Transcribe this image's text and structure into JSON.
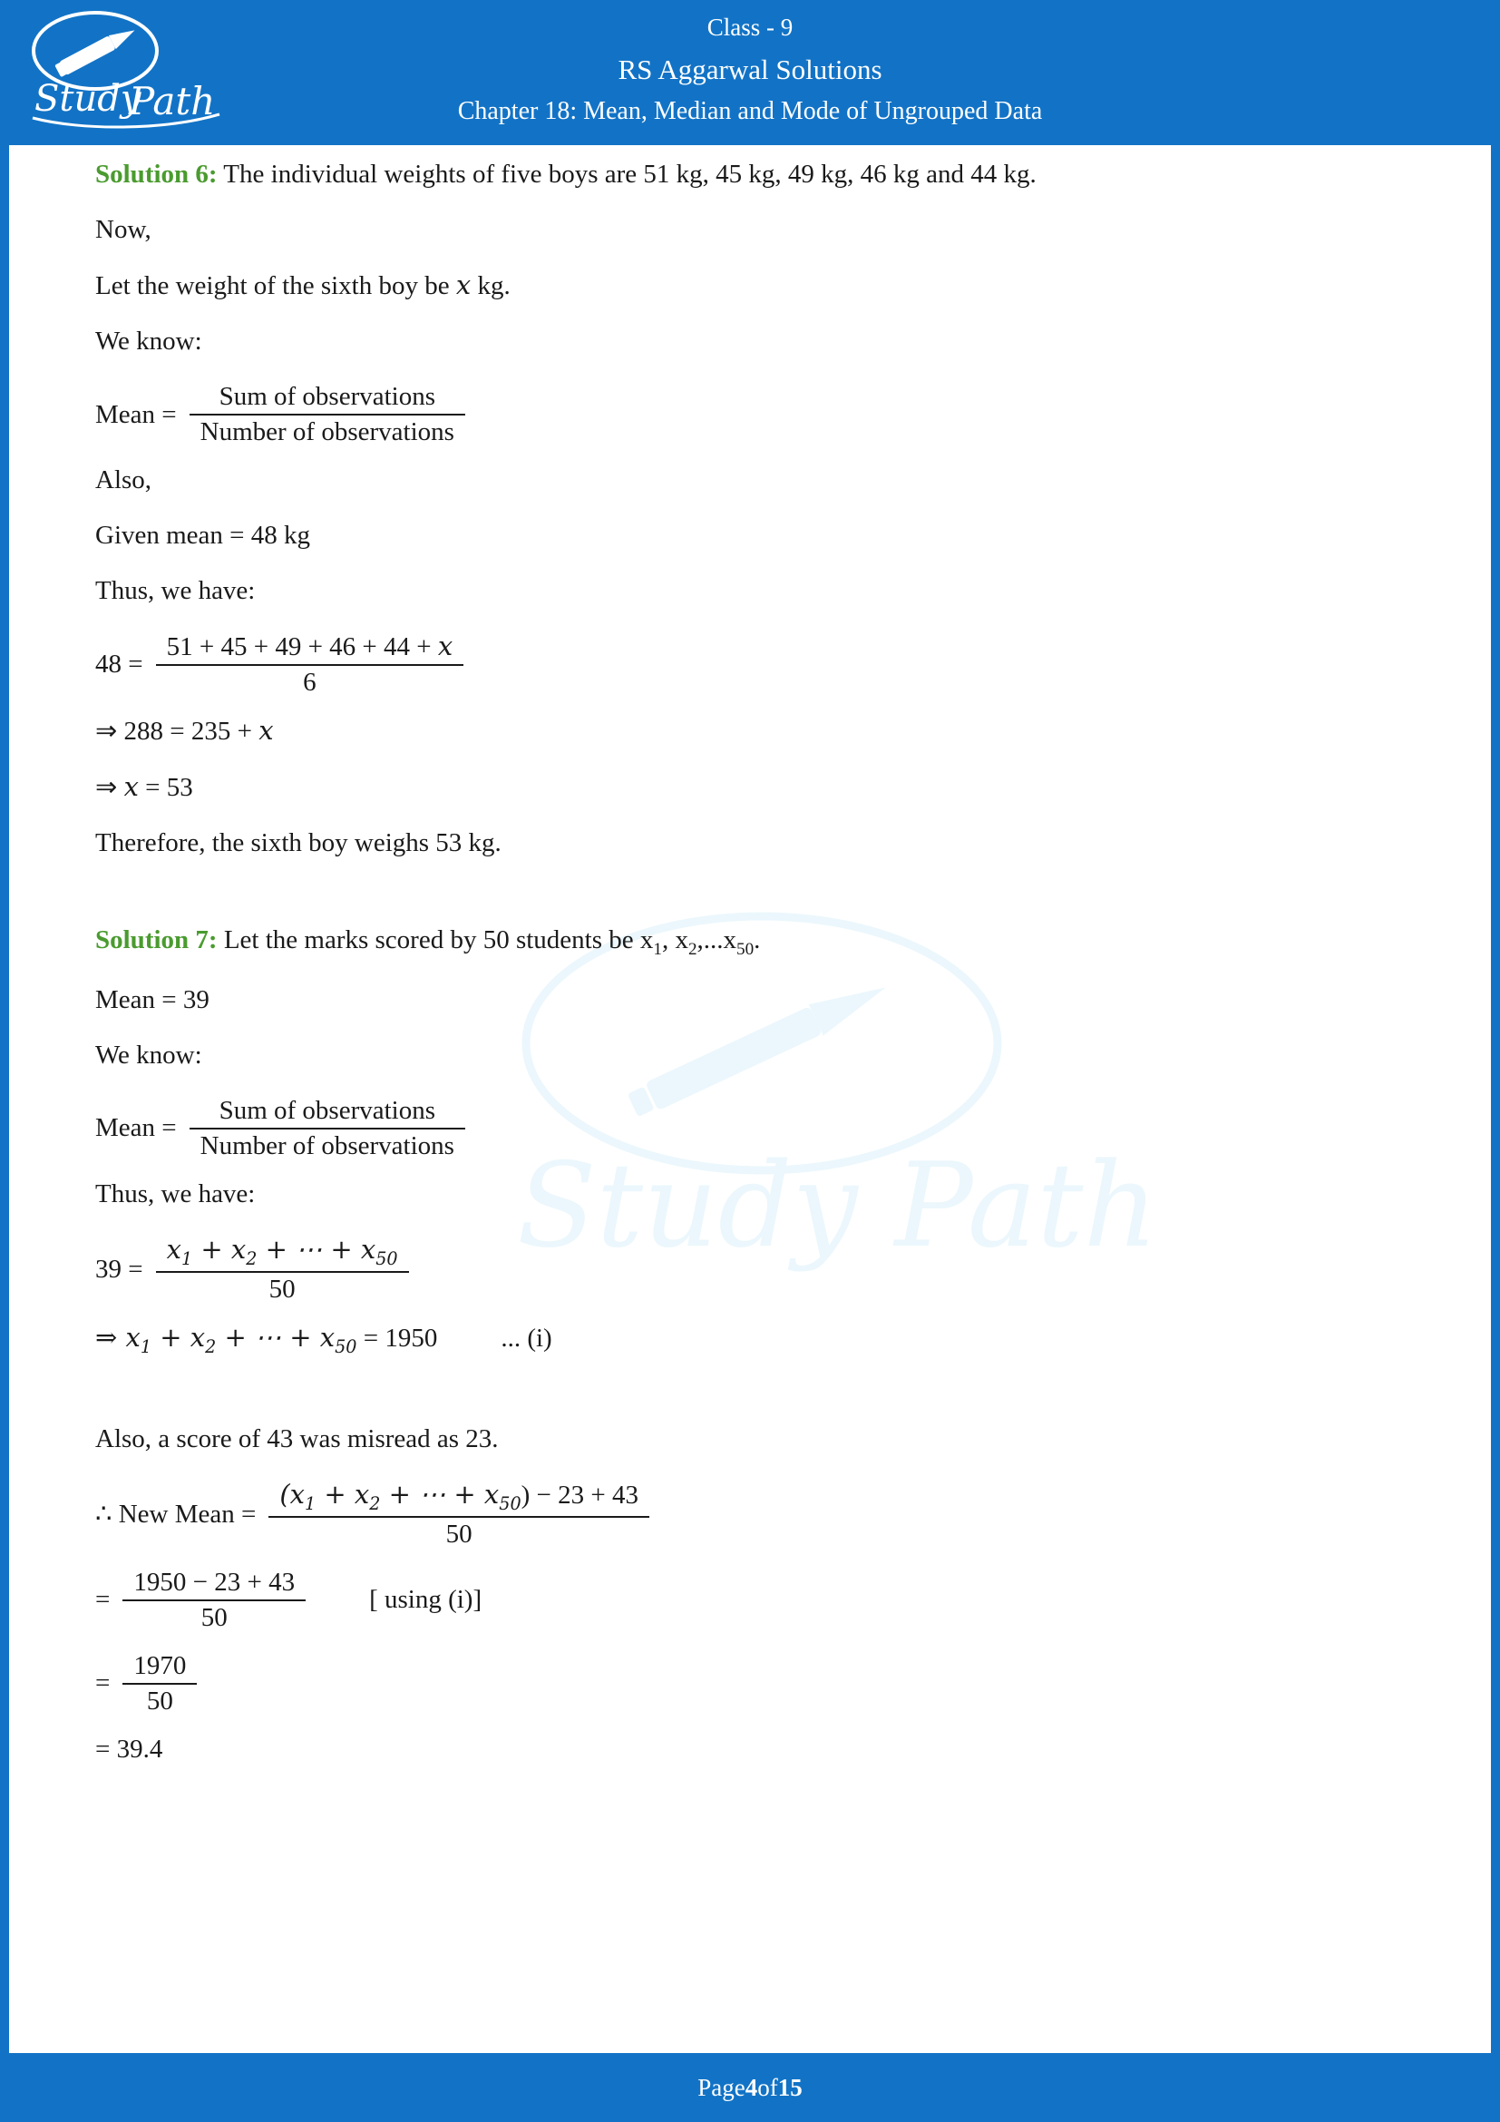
{
  "header": {
    "logo_text": "Study Path",
    "line1": "Class - 9",
    "line2": "RS Aggarwal Solutions",
    "line3": "Chapter 18: Mean, Median and Mode of Ungrouped Data",
    "bg_color": "#1273c6"
  },
  "watermark": {
    "text": "Study Path"
  },
  "footer": {
    "prefix": "Page ",
    "page": "4",
    "middle": " of ",
    "total": "15"
  },
  "solution6": {
    "label": "Solution 6:",
    "intro": " The individual weights of five boys are 51 kg, 45 kg, 49 kg, 46 kg and 44 kg.",
    "now": "Now,",
    "let_line_a": "Let the weight of the sixth boy be ",
    "let_var": "x",
    "let_line_b": " kg.",
    "we_know": "We know:",
    "mean_label": "Mean  =",
    "mean_num": "Sum of observations",
    "mean_den": "Number of observations",
    "also": "Also,",
    "given_mean": "Given mean = 48 kg",
    "thus": "Thus, we have:",
    "eq_lead": "48 =",
    "eq_num": "51 + 45 + 49 + 46 + 44 + ",
    "eq_num_var": "x",
    "eq_den": "6",
    "step1": "⇒ 288  =  235 + ",
    "step1_var": "x",
    "step2_pre": "⇒ ",
    "step2_var": "x",
    "step2_post": " = 53",
    "conclusion": "Therefore, the sixth boy weighs 53 kg."
  },
  "solution7": {
    "label": "Solution 7:",
    "intro_a": " Let the marks scored by 50 students be x",
    "sub1": "1",
    "intro_b": ", x",
    "sub2": "2",
    "intro_c": ",...x",
    "sub50": "50",
    "intro_d": ".",
    "mean_given": "Mean = 39",
    "we_know": "We know:",
    "mean_label": "Mean  =",
    "mean_num": "Sum of observations",
    "mean_den": "Number of observations",
    "thus": "Thus, we have:",
    "eq_lead": "39 =",
    "eq_num_pre": "x",
    "eq_num_s1": "1",
    "eq_num_mid": " + x",
    "eq_num_s2": "2",
    "eq_num_mid2": " + ⋯ + x",
    "eq_num_s50": "50",
    "eq_den": "50",
    "sum_line_pre": "⇒ x",
    "sum_s1": "1",
    "sum_mid": " + x",
    "sum_s2": "2",
    "sum_mid2": " + ⋯ + x",
    "sum_s50": "50",
    "sum_post": " = 1950",
    "sum_ref": "... (i)",
    "misread": "Also, a score of 43 was misread as 23.",
    "new_mean_lead": "∴ New Mean =",
    "new_mean_num_pre": "(x",
    "nm_s1": "1",
    "new_mean_num_mid": " + x",
    "nm_s2": "2",
    "new_mean_num_mid2": " + ⋯ + x",
    "nm_s50": "50",
    "new_mean_num_post": ") − 23 + 43",
    "new_mean_den": "50",
    "step2_lead": "=",
    "step2_num": "1950 − 23 + 43",
    "step2_den": "50",
    "step2_note": "[ using (i)]",
    "step3_lead": "=",
    "step3_num": "1970",
    "step3_den": "50",
    "result": "=  39.4"
  }
}
